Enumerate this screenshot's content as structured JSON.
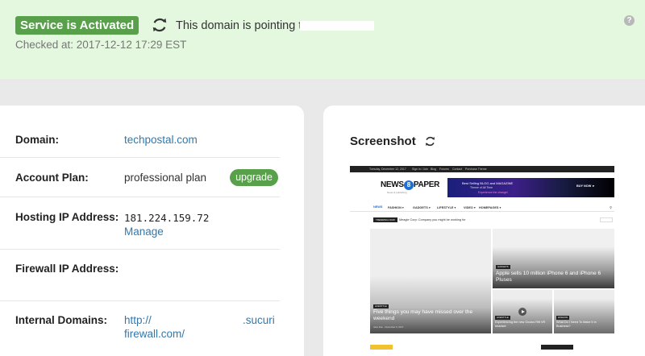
{
  "banner": {
    "status": "Service is Activated",
    "pointing": "This domain is pointing to",
    "checked_at": "Checked at: 2017-12-12 17:29 EST",
    "help": "?"
  },
  "info": {
    "domain_label": "Domain:",
    "domain_value": "techpostal.com",
    "plan_label": "Account Plan:",
    "plan_value": "professional plan",
    "upgrade": "upgrade",
    "hosting_label": "Hosting IP Address:",
    "hosting_value": "181.224.159.72",
    "manage": "Manage",
    "firewall_label": "Firewall IP Address:",
    "internal_label": "Internal Domains:",
    "internal_line1_a": "http://",
    "internal_line1_b": ".sucuri",
    "internal_line2": "firewall.com/"
  },
  "screenshot": {
    "title": "Screenshot",
    "site": {
      "topbar": [
        "Tuesday, December 12, 2017",
        "Sign in / Join",
        "Blog",
        "Forums",
        "Contact",
        "Purchase Theme"
      ],
      "logo_pre": "NEWS",
      "logo_eight": "8",
      "logo_post": "PAPER",
      "tagline": "News & publishing",
      "ad_line1": "Best Selling BLOG and MAGAZINE",
      "ad_line2": "Theme of All Time",
      "ad_line3": "Experience the change!",
      "ad_button": "BUY NOW ►",
      "nav": [
        "NEWS",
        "FASHION ▾",
        "GADGETS ▾",
        "LIFESTYLE ▾",
        "VIDEO ▾",
        "HOMEPAGES ▾"
      ],
      "trending_label": "TRENDING NOW",
      "trending_text": "Meagle Corp: Company you might be working for",
      "big_cat": "LIFESTYLE",
      "big_title": "Five things you may have missed over the weekend",
      "big_meta": "Jane Doe · December 9, 2017",
      "tr_cat": "GADGETS",
      "tr_title": "Apple sells 10 million iPhone 6 and iPhone 6 Pluses",
      "b1_cat": "LIFESTYLE",
      "b1_title": "Experiencing the new Oculus Rift VR headset",
      "b2_cat": "FASHION",
      "b2_title": "What Do I Need To Make It In Business?"
    }
  },
  "colors": {
    "accent_green": "#58a14a",
    "link_blue": "#2f79ad",
    "banner_bg": "#e4f7df"
  }
}
